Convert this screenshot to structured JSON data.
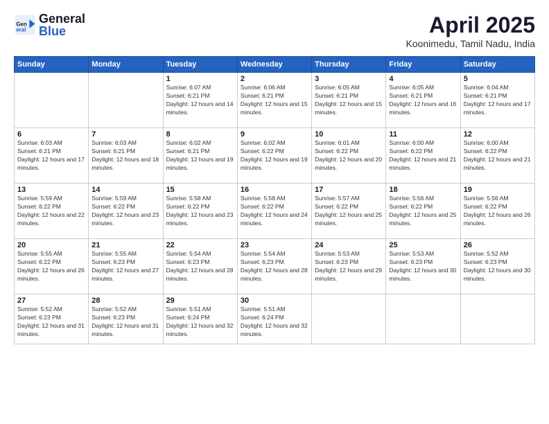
{
  "logo": {
    "general": "General",
    "blue": "Blue"
  },
  "header": {
    "title": "April 2025",
    "location": "Koonimedu, Tamil Nadu, India"
  },
  "weekdays": [
    "Sunday",
    "Monday",
    "Tuesday",
    "Wednesday",
    "Thursday",
    "Friday",
    "Saturday"
  ],
  "weeks": [
    [
      {
        "day": "",
        "empty": true
      },
      {
        "day": "",
        "empty": true
      },
      {
        "day": "1",
        "sunrise": "6:07 AM",
        "sunset": "6:21 PM",
        "daylight": "12 hours and 14 minutes."
      },
      {
        "day": "2",
        "sunrise": "6:06 AM",
        "sunset": "6:21 PM",
        "daylight": "12 hours and 15 minutes."
      },
      {
        "day": "3",
        "sunrise": "6:05 AM",
        "sunset": "6:21 PM",
        "daylight": "12 hours and 15 minutes."
      },
      {
        "day": "4",
        "sunrise": "6:05 AM",
        "sunset": "6:21 PM",
        "daylight": "12 hours and 16 minutes."
      },
      {
        "day": "5",
        "sunrise": "6:04 AM",
        "sunset": "6:21 PM",
        "daylight": "12 hours and 17 minutes."
      }
    ],
    [
      {
        "day": "6",
        "sunrise": "6:03 AM",
        "sunset": "6:21 PM",
        "daylight": "12 hours and 17 minutes."
      },
      {
        "day": "7",
        "sunrise": "6:03 AM",
        "sunset": "6:21 PM",
        "daylight": "12 hours and 18 minutes."
      },
      {
        "day": "8",
        "sunrise": "6:02 AM",
        "sunset": "6:21 PM",
        "daylight": "12 hours and 19 minutes."
      },
      {
        "day": "9",
        "sunrise": "6:02 AM",
        "sunset": "6:22 PM",
        "daylight": "12 hours and 19 minutes."
      },
      {
        "day": "10",
        "sunrise": "6:01 AM",
        "sunset": "6:22 PM",
        "daylight": "12 hours and 20 minutes."
      },
      {
        "day": "11",
        "sunrise": "6:00 AM",
        "sunset": "6:22 PM",
        "daylight": "12 hours and 21 minutes."
      },
      {
        "day": "12",
        "sunrise": "6:00 AM",
        "sunset": "6:22 PM",
        "daylight": "12 hours and 21 minutes."
      }
    ],
    [
      {
        "day": "13",
        "sunrise": "5:59 AM",
        "sunset": "6:22 PM",
        "daylight": "12 hours and 22 minutes."
      },
      {
        "day": "14",
        "sunrise": "5:59 AM",
        "sunset": "6:22 PM",
        "daylight": "12 hours and 23 minutes."
      },
      {
        "day": "15",
        "sunrise": "5:58 AM",
        "sunset": "6:22 PM",
        "daylight": "12 hours and 23 minutes."
      },
      {
        "day": "16",
        "sunrise": "5:58 AM",
        "sunset": "6:22 PM",
        "daylight": "12 hours and 24 minutes."
      },
      {
        "day": "17",
        "sunrise": "5:57 AM",
        "sunset": "6:22 PM",
        "daylight": "12 hours and 25 minutes."
      },
      {
        "day": "18",
        "sunrise": "5:56 AM",
        "sunset": "6:22 PM",
        "daylight": "12 hours and 25 minutes."
      },
      {
        "day": "19",
        "sunrise": "5:56 AM",
        "sunset": "6:22 PM",
        "daylight": "12 hours and 26 minutes."
      }
    ],
    [
      {
        "day": "20",
        "sunrise": "5:55 AM",
        "sunset": "6:22 PM",
        "daylight": "12 hours and 26 minutes."
      },
      {
        "day": "21",
        "sunrise": "5:55 AM",
        "sunset": "6:23 PM",
        "daylight": "12 hours and 27 minutes."
      },
      {
        "day": "22",
        "sunrise": "5:54 AM",
        "sunset": "6:23 PM",
        "daylight": "12 hours and 28 minutes."
      },
      {
        "day": "23",
        "sunrise": "5:54 AM",
        "sunset": "6:23 PM",
        "daylight": "12 hours and 28 minutes."
      },
      {
        "day": "24",
        "sunrise": "5:53 AM",
        "sunset": "6:23 PM",
        "daylight": "12 hours and 29 minutes."
      },
      {
        "day": "25",
        "sunrise": "5:53 AM",
        "sunset": "6:23 PM",
        "daylight": "12 hours and 30 minutes."
      },
      {
        "day": "26",
        "sunrise": "5:52 AM",
        "sunset": "6:23 PM",
        "daylight": "12 hours and 30 minutes."
      }
    ],
    [
      {
        "day": "27",
        "sunrise": "5:52 AM",
        "sunset": "6:23 PM",
        "daylight": "12 hours and 31 minutes."
      },
      {
        "day": "28",
        "sunrise": "5:52 AM",
        "sunset": "6:23 PM",
        "daylight": "12 hours and 31 minutes."
      },
      {
        "day": "29",
        "sunrise": "5:51 AM",
        "sunset": "6:24 PM",
        "daylight": "12 hours and 32 minutes."
      },
      {
        "day": "30",
        "sunrise": "5:51 AM",
        "sunset": "6:24 PM",
        "daylight": "12 hours and 32 minutes."
      },
      {
        "day": "",
        "empty": true
      },
      {
        "day": "",
        "empty": true
      },
      {
        "day": "",
        "empty": true
      }
    ]
  ]
}
